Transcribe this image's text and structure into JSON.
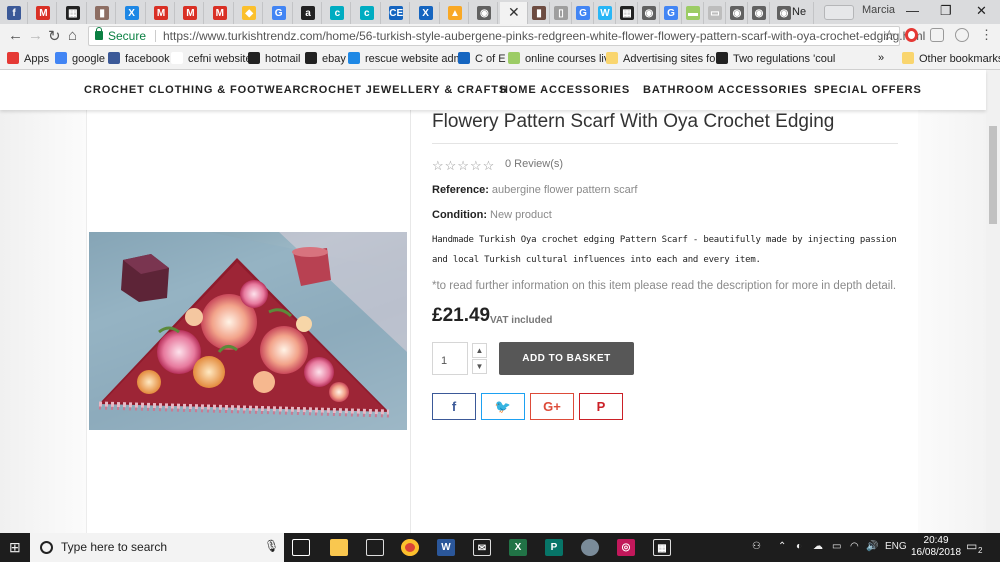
{
  "browser": {
    "tabs": [
      {
        "icon": "facebook-icon",
        "glyph": "f",
        "color": "#3b5998"
      },
      {
        "icon": "gmail-icon",
        "glyph": "M",
        "color": "#d93025"
      },
      {
        "icon": "shop-icon",
        "glyph": "▦",
        "color": "#222222"
      },
      {
        "icon": "book-icon",
        "glyph": "▮",
        "color": "#8d6e63"
      },
      {
        "icon": "rescue-icon",
        "glyph": "X",
        "color": "#1e88e5"
      },
      {
        "icon": "gmail-icon",
        "glyph": "M",
        "color": "#d93025"
      },
      {
        "icon": "gmail-icon",
        "glyph": "M",
        "color": "#d93025"
      },
      {
        "icon": "gmail-icon",
        "glyph": "M",
        "color": "#d93025"
      },
      {
        "icon": "paint-icon",
        "glyph": "◆",
        "color": "#fbc02d"
      },
      {
        "icon": "google-icon",
        "glyph": "G",
        "color": "#4285f4"
      },
      {
        "icon": "amazon-icon",
        "glyph": "a",
        "color": "#222222"
      },
      {
        "icon": "edge-icon",
        "glyph": "c",
        "color": "#00acc1"
      },
      {
        "icon": "edge-icon",
        "glyph": "c",
        "color": "#00acc1"
      },
      {
        "icon": "ce-icon",
        "glyph": "CE",
        "color": "#1565c0"
      },
      {
        "icon": "pinterest-icon",
        "glyph": "X",
        "color": "#1565c0"
      },
      {
        "icon": "chart-icon",
        "glyph": "▲",
        "color": "#f9a825"
      },
      {
        "icon": "drive-icon",
        "glyph": "◉",
        "color": "#616161"
      }
    ],
    "tabs_after": [
      {
        "icon": "book-icon",
        "glyph": "▮",
        "color": "#6d4c41"
      },
      {
        "icon": "doc-icon",
        "glyph": "▯",
        "color": "#9e9e9e"
      },
      {
        "icon": "google-icon",
        "glyph": "G",
        "color": "#4285f4"
      },
      {
        "icon": "w-icon",
        "glyph": "W",
        "color": "#29b6f6"
      },
      {
        "icon": "shop-icon",
        "glyph": "▦",
        "color": "#222222"
      },
      {
        "icon": "drive-icon",
        "glyph": "◉",
        "color": "#616161"
      },
      {
        "icon": "google-icon",
        "glyph": "G",
        "color": "#4285f4"
      },
      {
        "icon": "leaf-icon",
        "glyph": "▬",
        "color": "#9ccc65"
      },
      {
        "icon": "page-icon",
        "glyph": "▭",
        "color": "#bdbdbd"
      },
      {
        "icon": "drive-icon",
        "glyph": "◉",
        "color": "#616161"
      },
      {
        "icon": "drive-icon",
        "glyph": "◉",
        "color": "#616161"
      }
    ],
    "last_tab_label": "Ne",
    "profile_name": "Marcia",
    "url": "https://www.turkishtrendz.com/home/56-turkish-style-aubergene-pinks-redgreen-white-flower-flowery-pattern-scarf-with-oya-crochet-edging.html",
    "secure_label": "Secure"
  },
  "bookmarks": [
    {
      "label": "Apps",
      "icon": "apps-icon",
      "color": "#e53935"
    },
    {
      "label": "google",
      "icon": "google-icon",
      "color": "#4285f4"
    },
    {
      "label": "facebook",
      "icon": "facebook-icon",
      "color": "#3b5998"
    },
    {
      "label": "cefni website",
      "icon": "blank-icon",
      "color": "#ffffff"
    },
    {
      "label": "hotmail",
      "icon": "shop-icon",
      "color": "#222222"
    },
    {
      "label": "ebay",
      "icon": "shop-icon",
      "color": "#222222"
    },
    {
      "label": "rescue website admi",
      "icon": "rescue-icon",
      "color": "#1e88e5"
    },
    {
      "label": "C of E",
      "icon": "ce-icon",
      "color": "#1565c0"
    },
    {
      "label": "online courses live",
      "icon": "leaf-icon",
      "color": "#9ccc65"
    },
    {
      "label": "Advertising sites for",
      "icon": "folder-icon",
      "color": "#f9d56e"
    },
    {
      "label": "Two regulations 'coul",
      "icon": "arrow-icon",
      "color": "#222222"
    },
    {
      "label": "Other bookmarks",
      "icon": "folder-icon",
      "color": "#f9d56e"
    }
  ],
  "site_nav": [
    "CROCHET CLOTHING & FOOTWEAR",
    "CROCHET JEWELLERY & CRAFTS",
    "HOME ACCESSORIES",
    "BATHROOM ACCESSORIES",
    "SPECIAL OFFERS"
  ],
  "product": {
    "title": "Flowery Pattern Scarf With Oya Crochet Edging",
    "stars": "☆☆☆☆☆",
    "reviews": "0 Review(s)",
    "reference_label": "Reference:",
    "reference_value": "aubergine flower pattern scarf",
    "condition_label": "Condition:",
    "condition_value": "New product",
    "description": "Handmade Turkish Oya crochet edging Pattern Scarf - beautifully made by injecting passion and local Turkish cultural influences into each and every item.",
    "note": "*to read further information on this item please read the description for more in depth detail.",
    "price": "£21.49",
    "vat": "VAT included",
    "quantity": "1",
    "add_to_basket": "ADD TO BASKET",
    "share": [
      {
        "name": "facebook-share-button",
        "glyph": "f",
        "color": "#3b5998"
      },
      {
        "name": "twitter-share-button",
        "glyph": "🐦",
        "color": "#1da1f2"
      },
      {
        "name": "google-plus-share-button",
        "glyph": "G+",
        "color": "#dd4b39"
      },
      {
        "name": "pinterest-share-button",
        "glyph": "P",
        "color": "#cb2027"
      }
    ]
  },
  "taskbar": {
    "search_placeholder": "Type here to search",
    "language": "ENG",
    "time": "20:49",
    "date": "16/08/2018",
    "notification_count": "2"
  }
}
